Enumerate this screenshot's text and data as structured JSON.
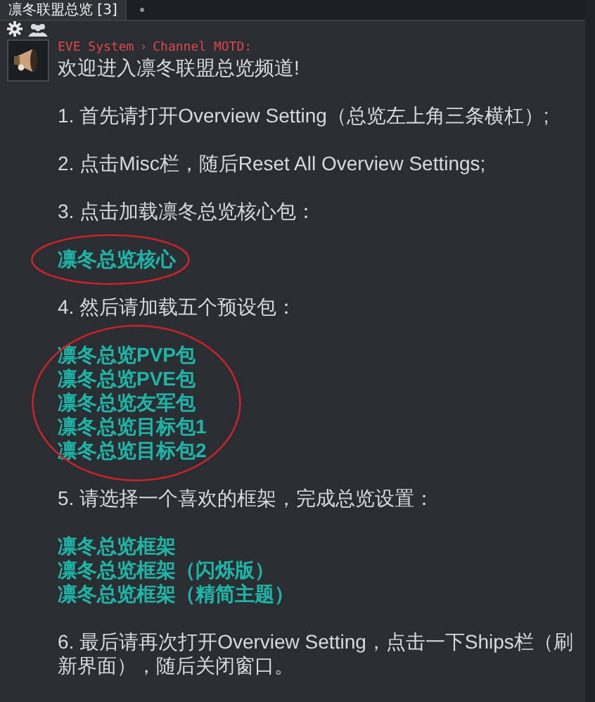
{
  "tabs": [
    {
      "label": "凛冬联盟总览 [3]",
      "selected": true
    }
  ],
  "message": {
    "sender": "EVE System",
    "arrow": "›",
    "channel": "Channel MOTD:",
    "blocks": [
      {
        "kind": "text",
        "text": "欢迎进入凛冬联盟总览频道!"
      },
      {
        "kind": "text",
        "text": "1. 首先请打开Overview Setting（总览左上角三条横杠）;"
      },
      {
        "kind": "text",
        "text": "2. 点击Misc栏，随后Reset All Overview Settings;"
      },
      {
        "kind": "text",
        "text": "3. 点击加载凛冬总览核心包："
      },
      {
        "kind": "links",
        "circled": true,
        "links": [
          "凛冬总览核心"
        ]
      },
      {
        "kind": "text",
        "text": "4. 然后请加载五个预设包："
      },
      {
        "kind": "links",
        "circled": true,
        "links": [
          "凛冬总览PVP包",
          "凛冬总览PVE包",
          "凛冬总览友军包",
          "凛冬总览目标包1",
          "凛冬总览目标包2"
        ]
      },
      {
        "kind": "text",
        "text": "5. 请选择一个喜欢的框架，完成总览设置："
      },
      {
        "kind": "links",
        "circled": false,
        "links": [
          "凛冬总览框架",
          "凛冬总览框架（闪烁版）",
          "凛冬总览框架（精简主题）"
        ]
      },
      {
        "kind": "text",
        "text": "6. 最后请再次打开Overview Setting，点击一下Ships栏（刷新界面），随后关闭窗口。"
      }
    ]
  }
}
